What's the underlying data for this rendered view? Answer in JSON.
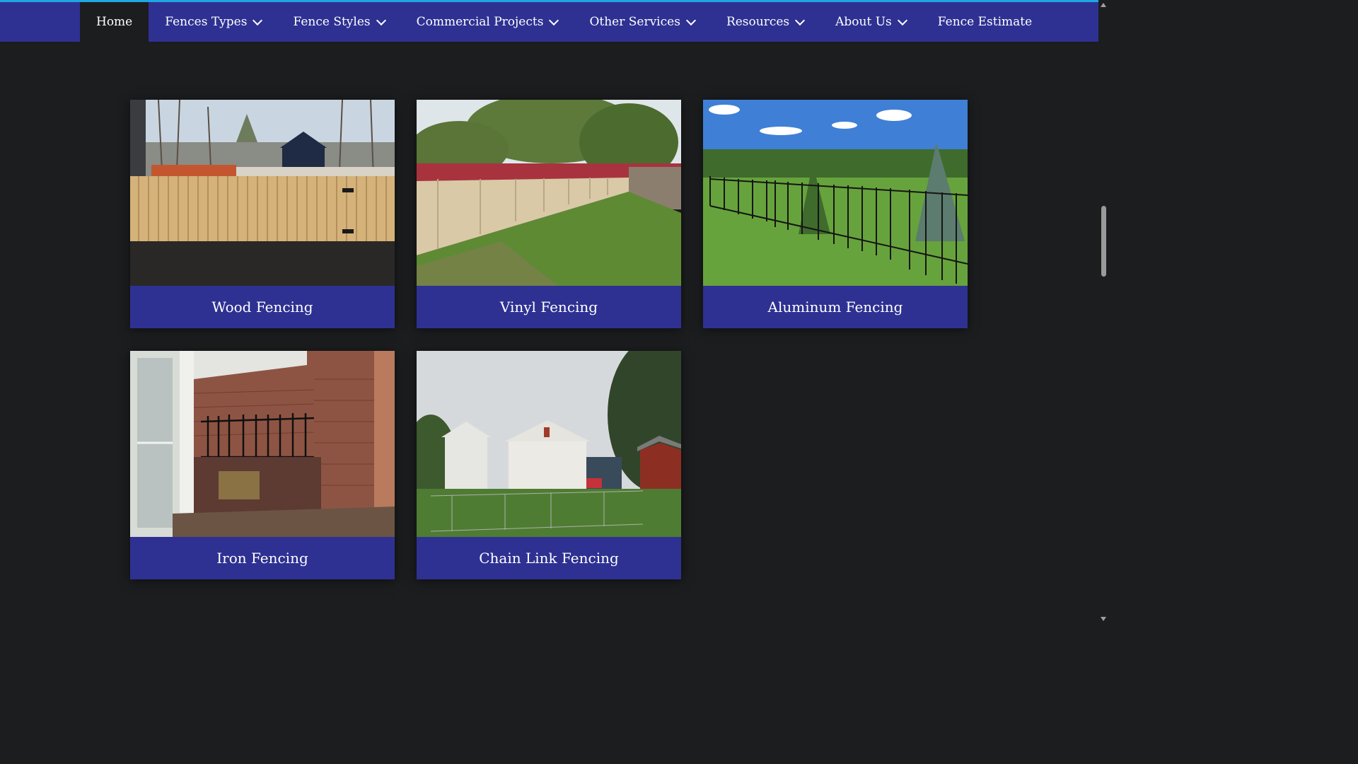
{
  "nav": {
    "items": [
      {
        "label": "Home",
        "dropdown": false,
        "active": true
      },
      {
        "label": "Fences Types",
        "dropdown": true
      },
      {
        "label": "Fence Styles",
        "dropdown": true
      },
      {
        "label": "Commercial Projects",
        "dropdown": true
      },
      {
        "label": "Other Services",
        "dropdown": true
      },
      {
        "label": "Resources",
        "dropdown": true
      },
      {
        "label": "About Us",
        "dropdown": true
      },
      {
        "label": "Fence Estimate",
        "dropdown": false
      }
    ]
  },
  "cards": [
    {
      "title": "Wood Fencing"
    },
    {
      "title": "Vinyl Fencing"
    },
    {
      "title": "Aluminum Fencing"
    },
    {
      "title": "Iron Fencing"
    },
    {
      "title": "Chain Link Fencing"
    }
  ],
  "colors": {
    "nav_bg": "#2e3192",
    "accent_line": "#1ea7e4",
    "page_bg": "#1c1d1f"
  },
  "icons": [
    "chevron-down-icon",
    "scroll-up-arrow-icon",
    "scroll-down-arrow-icon"
  ]
}
